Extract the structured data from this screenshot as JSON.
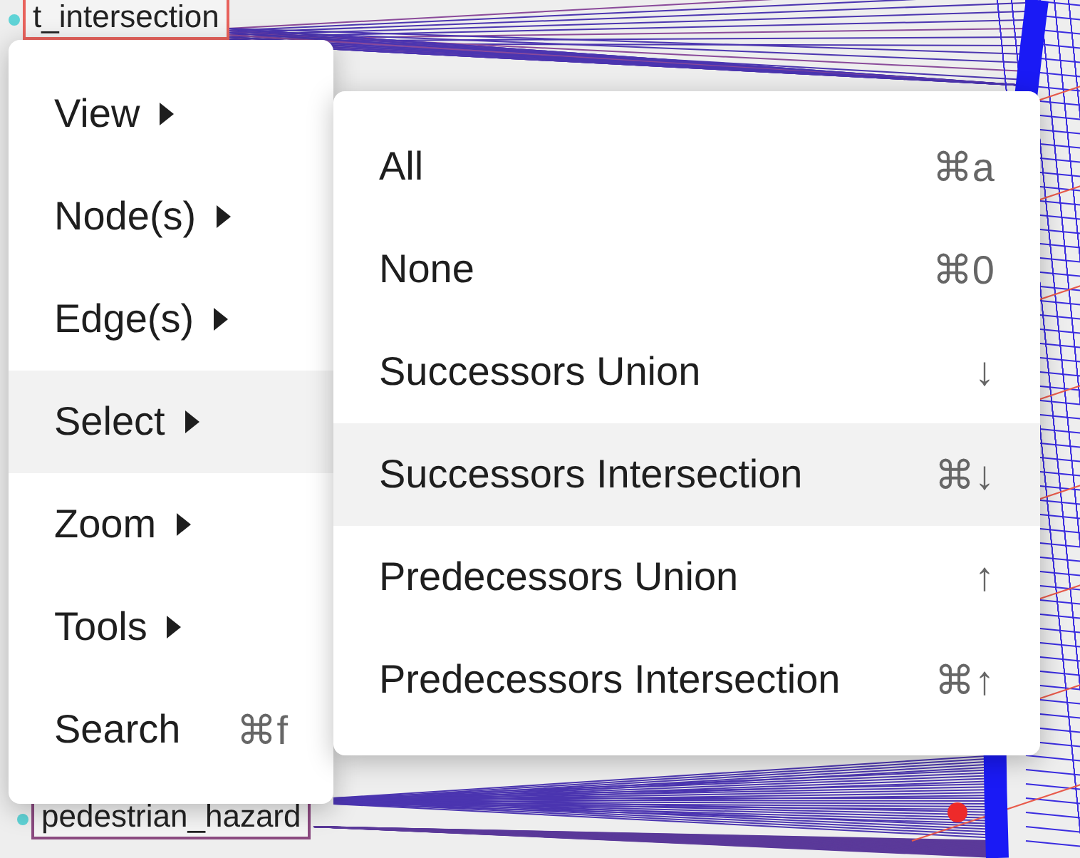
{
  "graph": {
    "nodes": [
      {
        "label": "t_intersection",
        "color": "#e8625c"
      },
      {
        "label": "pedestrian_hazard",
        "color": "#8b4a80"
      }
    ]
  },
  "menu": {
    "items": [
      {
        "label": "View",
        "kind": "submenu",
        "selected": false
      },
      {
        "label": "Node(s)",
        "kind": "submenu",
        "selected": false
      },
      {
        "label": "Edge(s)",
        "kind": "submenu",
        "selected": false
      },
      {
        "label": "Select",
        "kind": "submenu",
        "selected": true
      },
      {
        "label": "Zoom",
        "kind": "submenu",
        "selected": false
      },
      {
        "label": "Tools",
        "kind": "submenu",
        "selected": false
      },
      {
        "label": "Search",
        "kind": "shortcut",
        "shortcut": "⌘f",
        "selected": false
      }
    ]
  },
  "submenu": {
    "items": [
      {
        "label": "All",
        "shortcut": "⌘a",
        "selected": false
      },
      {
        "label": "None",
        "shortcut": "⌘0",
        "selected": false
      },
      {
        "label": "Successors Union",
        "shortcut": "↓",
        "selected": false
      },
      {
        "label": "Successors Intersection",
        "shortcut": "⌘↓",
        "selected": true
      },
      {
        "label": "Predecessors Union",
        "shortcut": "↑",
        "selected": false
      },
      {
        "label": "Predecessors Intersection",
        "shortcut": "⌘↑",
        "selected": false
      }
    ]
  }
}
